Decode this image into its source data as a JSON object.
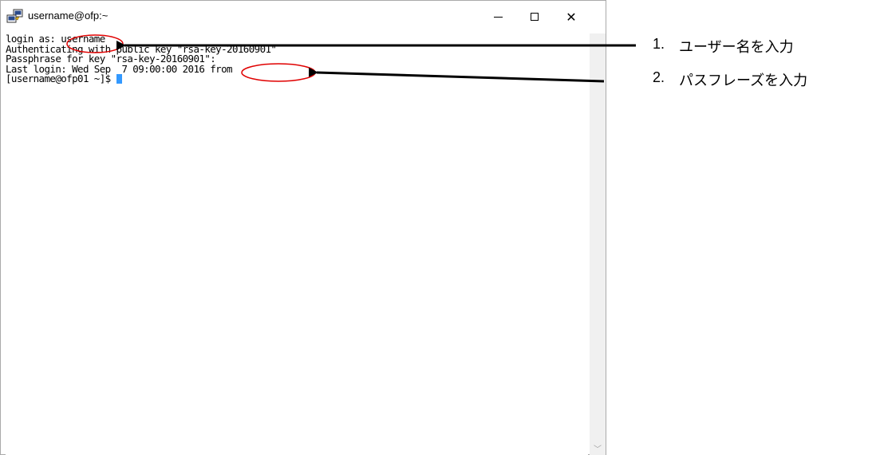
{
  "window": {
    "title": "username@ofp:~",
    "close_symbol": "✕"
  },
  "terminal": {
    "lines": [
      "login as: username",
      "Authenticating with public key \"rsa-key-20160901\"",
      "Passphrase for key \"rsa-key-20160901\":",
      "Last login: Wed Sep  7 09:00:00 2016 from",
      "[username@ofp01 ~]$ "
    ]
  },
  "scrollbar": {
    "up_icon": "chevron-up-icon",
    "down_icon": "chevron-down-icon",
    "down_symbol": "﹀"
  },
  "annotations": [
    {
      "number": "1.",
      "text": "ユーザー名を入力"
    },
    {
      "number": "2.",
      "text": "パスフレーズを入力"
    }
  ],
  "colors": {
    "highlight_ellipse": "#e00000",
    "arrow": "#000000",
    "cursor": "#3399ff"
  }
}
